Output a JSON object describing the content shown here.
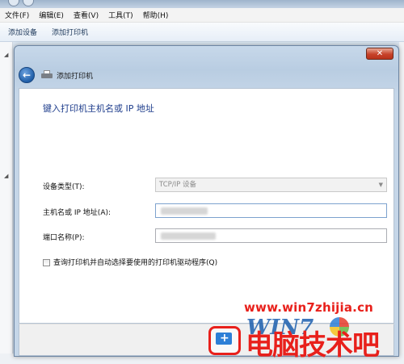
{
  "menubar": {
    "items": [
      "文件(F)",
      "编辑(E)",
      "查看(V)",
      "工具(T)",
      "帮助(H)"
    ]
  },
  "commandbar": {
    "buttons": [
      "添加设备",
      "添加打印机"
    ]
  },
  "dialog": {
    "title": "添加打印机",
    "heading": "键入打印机主机名或 IP 地址",
    "device_type": {
      "label": "设备类型(T):",
      "value": "TCP/IP 设备"
    },
    "hostname": {
      "label": "主机名或 IP 地址(A):",
      "value": ""
    },
    "port_name": {
      "label": "端口名称(P):",
      "value": ""
    },
    "query_checkbox": {
      "label": "查询打印机并自动选择要使用的打印机驱动程序(Q)",
      "checked": false
    }
  },
  "watermark": {
    "url": "www.win7zhijia.cn",
    "win7_text": "WIN7",
    "brand": "电脑技术吧"
  },
  "colors": {
    "heading": "#1e3d8c",
    "close_button": "#c7432a",
    "watermark_red": "#e8201b",
    "watermark_blue": "#1c5fae"
  }
}
